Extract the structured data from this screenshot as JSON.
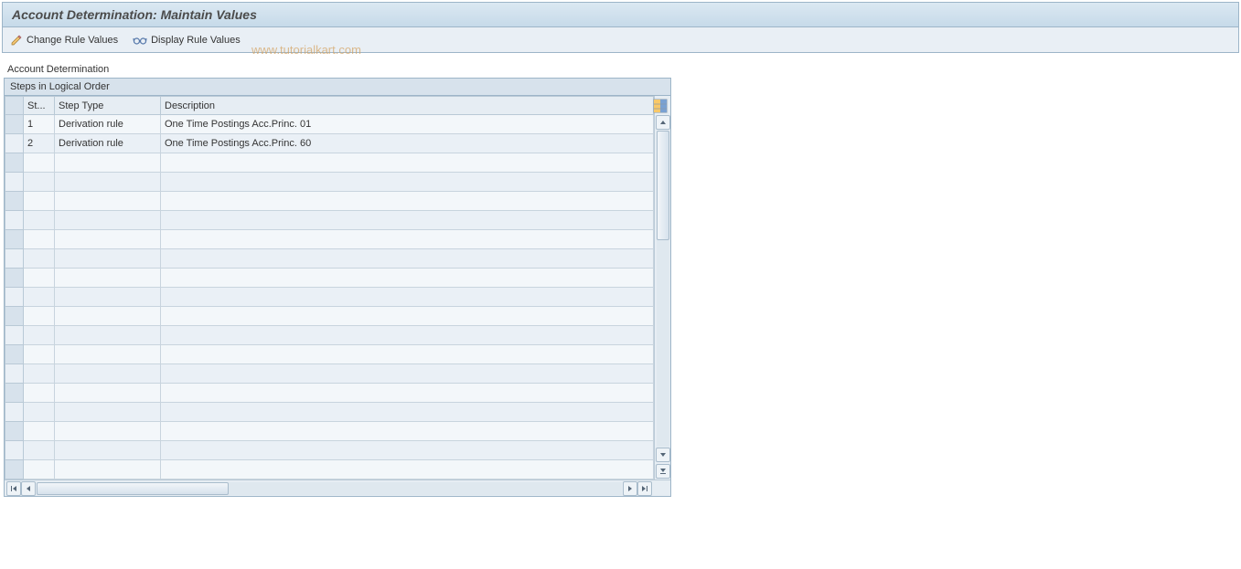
{
  "header": {
    "title": "Account Determination: Maintain Values"
  },
  "toolbar": {
    "change_rule_values": "Change Rule Values",
    "display_rule_values": "Display Rule Values"
  },
  "watermark": "www.tutorialkart.com",
  "main": {
    "section_label": "Account Determination",
    "panel_title": "Steps in Logical Order",
    "table": {
      "columns": {
        "st": "St...",
        "step_type": "Step Type",
        "description": "Description"
      },
      "rows": [
        {
          "st": "1",
          "step_type": "Derivation rule",
          "description": "One Time Postings Acc.Princ. 01"
        },
        {
          "st": "2",
          "step_type": "Derivation rule",
          "description": "One Time Postings Acc.Princ. 60"
        }
      ],
      "empty_row_count": 17
    }
  }
}
